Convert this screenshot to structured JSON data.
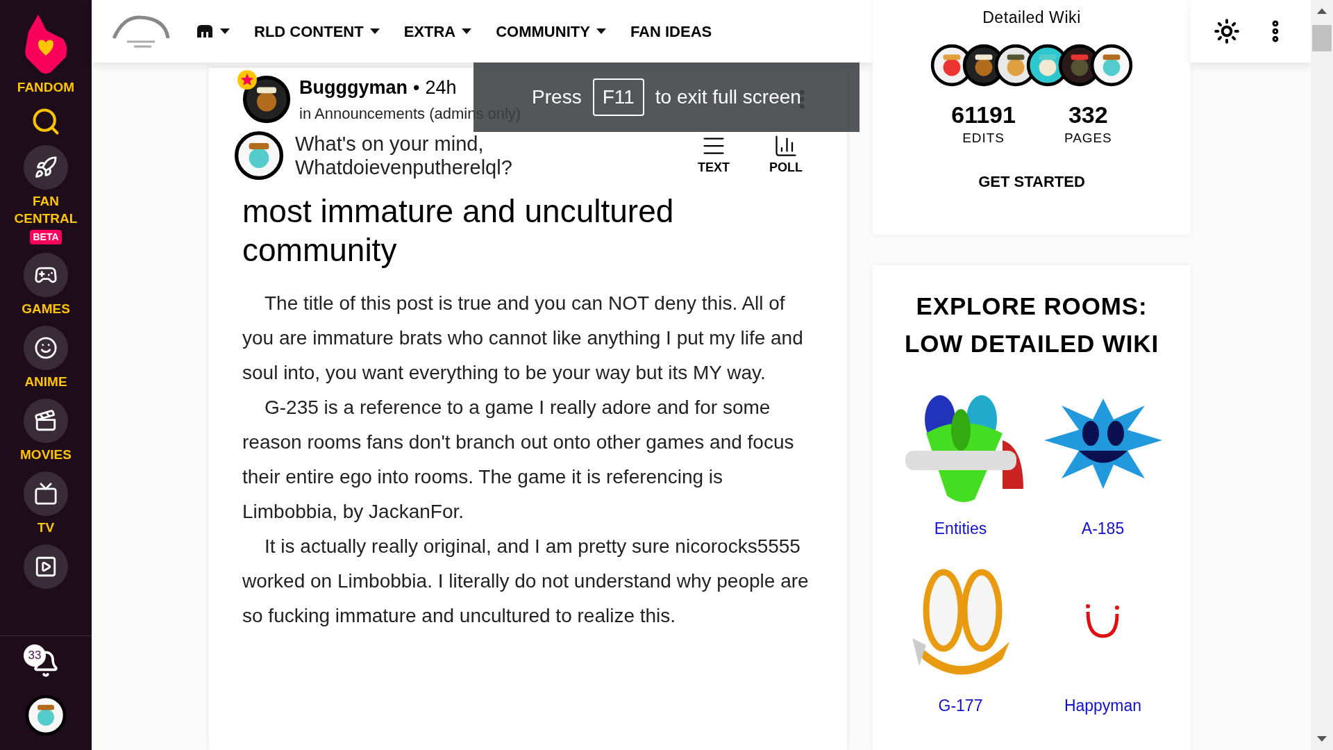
{
  "sidebar": {
    "brand": "FANDOM",
    "items": [
      {
        "kind": "search"
      },
      {
        "kind": "rocket",
        "label": "FAN CENTRAL",
        "badge": "BETA"
      },
      {
        "kind": "games",
        "label": "GAMES"
      },
      {
        "kind": "anime",
        "label": "ANIME"
      },
      {
        "kind": "movies",
        "label": "MOVIES"
      },
      {
        "kind": "tv",
        "label": "TV"
      },
      {
        "kind": "video"
      }
    ],
    "notifications": {
      "count": "33"
    }
  },
  "nav": {
    "items": [
      {
        "kind": "icon",
        "dropdown": true
      },
      {
        "kind": "text",
        "label": "RLD CONTENT",
        "dropdown": true
      },
      {
        "kind": "text",
        "label": "EXTRA",
        "dropdown": true
      },
      {
        "kind": "text",
        "label": "COMMUNITY",
        "dropdown": true
      },
      {
        "kind": "text",
        "label": "FAN IDEAS",
        "dropdown": false
      }
    ]
  },
  "post": {
    "author": "Bugggyman",
    "separator": "•",
    "time": "24h",
    "category": "in Announcements (admins only)",
    "composer": {
      "placeholder": "What's on your mind, Whatdoievenputherelql?",
      "actions": [
        {
          "kind": "text",
          "label": "TEXT"
        },
        {
          "kind": "poll",
          "label": "POLL"
        }
      ]
    },
    "title": "most immature and uncultured community",
    "paragraphs": [
      "The title of this post is true and you can NOT deny this. All of you are immature brats who cannot like anything I put my life and soul into, you want everything to be your way but its MY way.",
      "G-235 is a reference to a game I really adore and for some reason rooms fans don't branch out onto other games and focus their entire ego into rooms. The game it is referencing is Limbobbia, by JackanFor.",
      "It is actually really original, and I am pretty sure nicorocks5555 worked on Limbobbia. I literally do not understand why people are so fucking immature and uncultured to realize this."
    ]
  },
  "wiki": {
    "name": "Detailed Wiki",
    "stats": [
      {
        "value": "61191",
        "label": "EDITS"
      },
      {
        "value": "332",
        "label": "PAGES"
      }
    ],
    "cta": "GET STARTED"
  },
  "explore": {
    "title": "EXPLORE ROOMS: LOW DETAILED WIKI",
    "items": [
      {
        "label": "Entities",
        "kind": "blob"
      },
      {
        "label": "A-185",
        "kind": "splat"
      },
      {
        "label": "G-177",
        "kind": "rings"
      },
      {
        "label": "Happyman",
        "kind": "smile"
      }
    ]
  },
  "toast": {
    "before": "Press",
    "key": "F11",
    "after": "to exit full screen"
  }
}
